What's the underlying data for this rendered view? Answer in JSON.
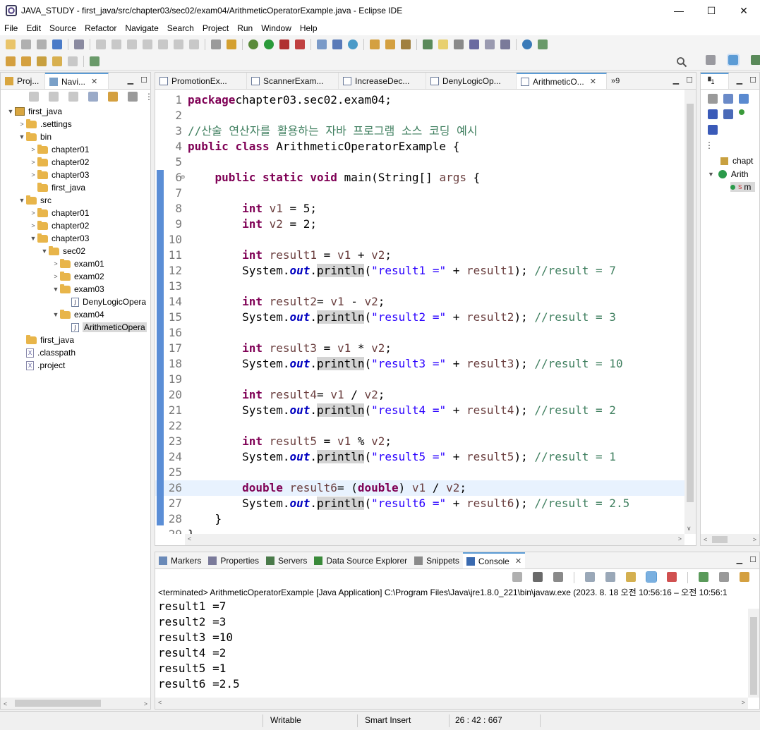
{
  "window": {
    "title": "JAVA_STUDY - first_java/src/chapter03/sec02/exam04/ArithmeticOperatorExample.java - Eclipse IDE",
    "minimize": "—",
    "maximize": "☐",
    "close": "✕"
  },
  "menu": [
    "File",
    "Edit",
    "Source",
    "Refactor",
    "Navigate",
    "Search",
    "Project",
    "Run",
    "Window",
    "Help"
  ],
  "left_panel": {
    "tabs": [
      {
        "label": "Proj..."
      },
      {
        "label": "Navi...",
        "close": "✕"
      }
    ],
    "tree": [
      {
        "label": "first_java",
        "depth": 0,
        "kind": "project",
        "arrow": "▼"
      },
      {
        "label": ".settings",
        "depth": 1,
        "kind": "folder",
        "arrow": ">"
      },
      {
        "label": "bin",
        "depth": 1,
        "kind": "folder",
        "arrow": "▼"
      },
      {
        "label": "chapter01",
        "depth": 2,
        "kind": "folder",
        "arrow": ">"
      },
      {
        "label": "chapter02",
        "depth": 2,
        "kind": "folder",
        "arrow": ">"
      },
      {
        "label": "chapter03",
        "depth": 2,
        "kind": "folder",
        "arrow": ">"
      },
      {
        "label": "first_java",
        "depth": 2,
        "kind": "folder",
        "arrow": ""
      },
      {
        "label": "src",
        "depth": 1,
        "kind": "folder",
        "arrow": "▼"
      },
      {
        "label": "chapter01",
        "depth": 2,
        "kind": "folder",
        "arrow": ">"
      },
      {
        "label": "chapter02",
        "depth": 2,
        "kind": "folder",
        "arrow": ">"
      },
      {
        "label": "chapter03",
        "depth": 2,
        "kind": "folder",
        "arrow": "▼"
      },
      {
        "label": "sec02",
        "depth": 3,
        "kind": "folder",
        "arrow": "▼"
      },
      {
        "label": "exam01",
        "depth": 4,
        "kind": "folder",
        "arrow": ">"
      },
      {
        "label": "exam02",
        "depth": 4,
        "kind": "folder",
        "arrow": ">"
      },
      {
        "label": "exam03",
        "depth": 4,
        "kind": "folder",
        "arrow": "▼"
      },
      {
        "label": "DenyLogicOpera",
        "depth": 5,
        "kind": "java",
        "arrow": ""
      },
      {
        "label": "exam04",
        "depth": 4,
        "kind": "folder",
        "arrow": "▼"
      },
      {
        "label": "ArithmeticOpera",
        "depth": 5,
        "kind": "java",
        "arrow": "",
        "selected": true
      },
      {
        "label": "first_java",
        "depth": 1,
        "kind": "folder",
        "arrow": ""
      },
      {
        "label": ".classpath",
        "depth": 1,
        "kind": "xfile",
        "arrow": ""
      },
      {
        "label": ".project",
        "depth": 1,
        "kind": "xfile",
        "arrow": ""
      }
    ]
  },
  "editor": {
    "tabs": [
      {
        "label": "PromotionEx..."
      },
      {
        "label": "ScannerExam..."
      },
      {
        "label": "IncreaseDec..."
      },
      {
        "label": "DenyLogicOp..."
      },
      {
        "label": "ArithmeticO...",
        "active": true,
        "close": "✕"
      }
    ],
    "overflow": "»9",
    "lines": [
      {
        "n": "1",
        "tokens": [
          [
            "kw",
            "package"
          ],
          [
            "",
            "chapter03.sec02.exam04;"
          ]
        ]
      },
      {
        "n": "2",
        "tokens": []
      },
      {
        "n": "3",
        "tokens": [
          [
            "cm",
            "//산술 연산자를 활용하는 자바 프로그램 소스 코딩 예시"
          ]
        ]
      },
      {
        "n": "4",
        "tokens": [
          [
            "kw",
            "public"
          ],
          [
            "",
            " "
          ],
          [
            "kw",
            "class"
          ],
          [
            "",
            " ArithmeticOperatorExample {"
          ]
        ]
      },
      {
        "n": "5",
        "tokens": []
      },
      {
        "n": "6",
        "tokens": [
          [
            "",
            "    "
          ],
          [
            "kw",
            "public"
          ],
          [
            "",
            " "
          ],
          [
            "kw",
            "static"
          ],
          [
            "",
            " "
          ],
          [
            "kw",
            "void"
          ],
          [
            "",
            " main(String[] "
          ],
          [
            "var",
            "args"
          ],
          [
            "",
            " {"
          ]
        ]
      },
      {
        "n": "7",
        "tokens": []
      },
      {
        "n": "8",
        "tokens": [
          [
            "",
            "        "
          ],
          [
            "kw",
            "int"
          ],
          [
            "",
            " "
          ],
          [
            "var",
            "v1"
          ],
          [
            "",
            " = 5;"
          ]
        ]
      },
      {
        "n": "9",
        "tokens": [
          [
            "",
            "        "
          ],
          [
            "kw",
            "int"
          ],
          [
            "",
            " "
          ],
          [
            "var",
            "v2"
          ],
          [
            "",
            " = 2;"
          ]
        ]
      },
      {
        "n": "10",
        "tokens": []
      },
      {
        "n": "11",
        "tokens": [
          [
            "",
            "        "
          ],
          [
            "kw",
            "int"
          ],
          [
            "",
            " "
          ],
          [
            "var",
            "result1"
          ],
          [
            "",
            " = "
          ],
          [
            "var",
            "v1"
          ],
          [
            "",
            " + "
          ],
          [
            "var",
            "v2"
          ],
          [
            "",
            ";"
          ]
        ]
      },
      {
        "n": "12",
        "tokens": [
          [
            "",
            "        System."
          ],
          [
            "fld",
            "out"
          ],
          [
            "",
            "."
          ],
          [
            "mhl",
            "println"
          ],
          [
            "",
            "("
          ],
          [
            "str",
            "\"result1 =\""
          ],
          [
            "",
            " + "
          ],
          [
            "var",
            "result1"
          ],
          [
            "",
            "); "
          ],
          [
            "cm",
            "//result = 7"
          ]
        ]
      },
      {
        "n": "13",
        "tokens": []
      },
      {
        "n": "14",
        "tokens": [
          [
            "",
            "        "
          ],
          [
            "kw",
            "int"
          ],
          [
            "",
            " "
          ],
          [
            "var",
            "result2"
          ],
          [
            "",
            "= "
          ],
          [
            "var",
            "v1"
          ],
          [
            "",
            " - "
          ],
          [
            "var",
            "v2"
          ],
          [
            "",
            ";"
          ]
        ]
      },
      {
        "n": "15",
        "tokens": [
          [
            "",
            "        System."
          ],
          [
            "fld",
            "out"
          ],
          [
            "",
            "."
          ],
          [
            "mhl",
            "println"
          ],
          [
            "",
            "("
          ],
          [
            "str",
            "\"result2 =\""
          ],
          [
            "",
            " + "
          ],
          [
            "var",
            "result2"
          ],
          [
            "",
            "); "
          ],
          [
            "cm",
            "//result = 3"
          ]
        ]
      },
      {
        "n": "16",
        "tokens": []
      },
      {
        "n": "17",
        "tokens": [
          [
            "",
            "        "
          ],
          [
            "kw",
            "int"
          ],
          [
            "",
            " "
          ],
          [
            "var",
            "result3"
          ],
          [
            "",
            " = "
          ],
          [
            "var",
            "v1"
          ],
          [
            "",
            " * "
          ],
          [
            "var",
            "v2"
          ],
          [
            "",
            ";"
          ]
        ]
      },
      {
        "n": "18",
        "tokens": [
          [
            "",
            "        System."
          ],
          [
            "fld",
            "out"
          ],
          [
            "",
            "."
          ],
          [
            "mhl",
            "println"
          ],
          [
            "",
            "("
          ],
          [
            "str",
            "\"result3 =\""
          ],
          [
            "",
            " + "
          ],
          [
            "var",
            "result3"
          ],
          [
            "",
            "); "
          ],
          [
            "cm",
            "//result = 10"
          ]
        ]
      },
      {
        "n": "19",
        "tokens": []
      },
      {
        "n": "20",
        "tokens": [
          [
            "",
            "        "
          ],
          [
            "kw",
            "int"
          ],
          [
            "",
            " "
          ],
          [
            "var",
            "result4"
          ],
          [
            "",
            "= "
          ],
          [
            "var",
            "v1"
          ],
          [
            "",
            " / "
          ],
          [
            "var",
            "v2"
          ],
          [
            "",
            ";"
          ]
        ]
      },
      {
        "n": "21",
        "tokens": [
          [
            "",
            "        System."
          ],
          [
            "fld",
            "out"
          ],
          [
            "",
            "."
          ],
          [
            "mhl",
            "println"
          ],
          [
            "",
            "("
          ],
          [
            "str",
            "\"result4 =\""
          ],
          [
            "",
            " + "
          ],
          [
            "var",
            "result4"
          ],
          [
            "",
            "); "
          ],
          [
            "cm",
            "//result = 2"
          ]
        ]
      },
      {
        "n": "22",
        "tokens": []
      },
      {
        "n": "23",
        "tokens": [
          [
            "",
            "        "
          ],
          [
            "kw",
            "int"
          ],
          [
            "",
            " "
          ],
          [
            "var",
            "result5"
          ],
          [
            "",
            " = "
          ],
          [
            "var",
            "v1"
          ],
          [
            "",
            " % "
          ],
          [
            "var",
            "v2"
          ],
          [
            "",
            ";"
          ]
        ]
      },
      {
        "n": "24",
        "tokens": [
          [
            "",
            "        System."
          ],
          [
            "fld",
            "out"
          ],
          [
            "",
            "."
          ],
          [
            "mhl",
            "println"
          ],
          [
            "",
            "("
          ],
          [
            "str",
            "\"result5 =\""
          ],
          [
            "",
            " + "
          ],
          [
            "var",
            "result5"
          ],
          [
            "",
            "); "
          ],
          [
            "cm",
            "//result = 1"
          ]
        ]
      },
      {
        "n": "25",
        "tokens": []
      },
      {
        "n": "26",
        "tokens": [
          [
            "",
            "        "
          ],
          [
            "kw",
            "double"
          ],
          [
            "",
            " "
          ],
          [
            "var",
            "result6"
          ],
          [
            "",
            "= ("
          ],
          [
            "kw",
            "double"
          ],
          [
            "",
            ") "
          ],
          [
            "var",
            "v1"
          ],
          [
            "",
            " / "
          ],
          [
            "var",
            "v2"
          ],
          [
            "",
            ";"
          ]
        ],
        "current": true
      },
      {
        "n": "27",
        "tokens": [
          [
            "",
            "        System."
          ],
          [
            "fld",
            "out"
          ],
          [
            "",
            "."
          ],
          [
            "mhl",
            "println"
          ],
          [
            "",
            "("
          ],
          [
            "str",
            "\"result6 =\""
          ],
          [
            "",
            " + "
          ],
          [
            "var",
            "result6"
          ],
          [
            "",
            "); "
          ],
          [
            "cm",
            "//result = 2.5"
          ]
        ]
      },
      {
        "n": "28",
        "tokens": [
          [
            "",
            "    }"
          ]
        ]
      },
      {
        "n": "29",
        "tokens": [
          [
            "",
            "}"
          ]
        ]
      }
    ]
  },
  "right_panel": {
    "tab_label": "1",
    "outline": [
      {
        "label": "chapt"
      },
      {
        "label": "Arith",
        "arrow": "▼"
      },
      {
        "label": "m",
        "superscript": "S"
      }
    ]
  },
  "bottom_panel": {
    "tabs": [
      {
        "label": "Markers"
      },
      {
        "label": "Properties"
      },
      {
        "label": "Servers"
      },
      {
        "label": "Data Source Explorer"
      },
      {
        "label": "Snippets"
      },
      {
        "label": "Console",
        "active": true,
        "close": "✕"
      }
    ],
    "status_line": "<terminated> ArithmeticOperatorExample [Java Application] C:\\Program Files\\Java\\jre1.8.0_221\\bin\\javaw.exe  (2023. 8. 18 오전 10:56:16 – 오전 10:56:1",
    "output": [
      "result1 =7",
      "result2 =3",
      "result3 =10",
      "result4 =2",
      "result5 =1",
      "result6 =2.5"
    ]
  },
  "status_bar": {
    "writable": "Writable",
    "insert_mode": "Smart Insert",
    "position": "26 : 42 : 667"
  },
  "colors": {
    "keyword": "#7f0055",
    "comment": "#3f7f5f",
    "string": "#2a00ff",
    "local_var": "#6a3e3e",
    "static_field": "#0000c0",
    "change_bar": "#5b8ed6",
    "current_line": "#e8f2fe"
  }
}
